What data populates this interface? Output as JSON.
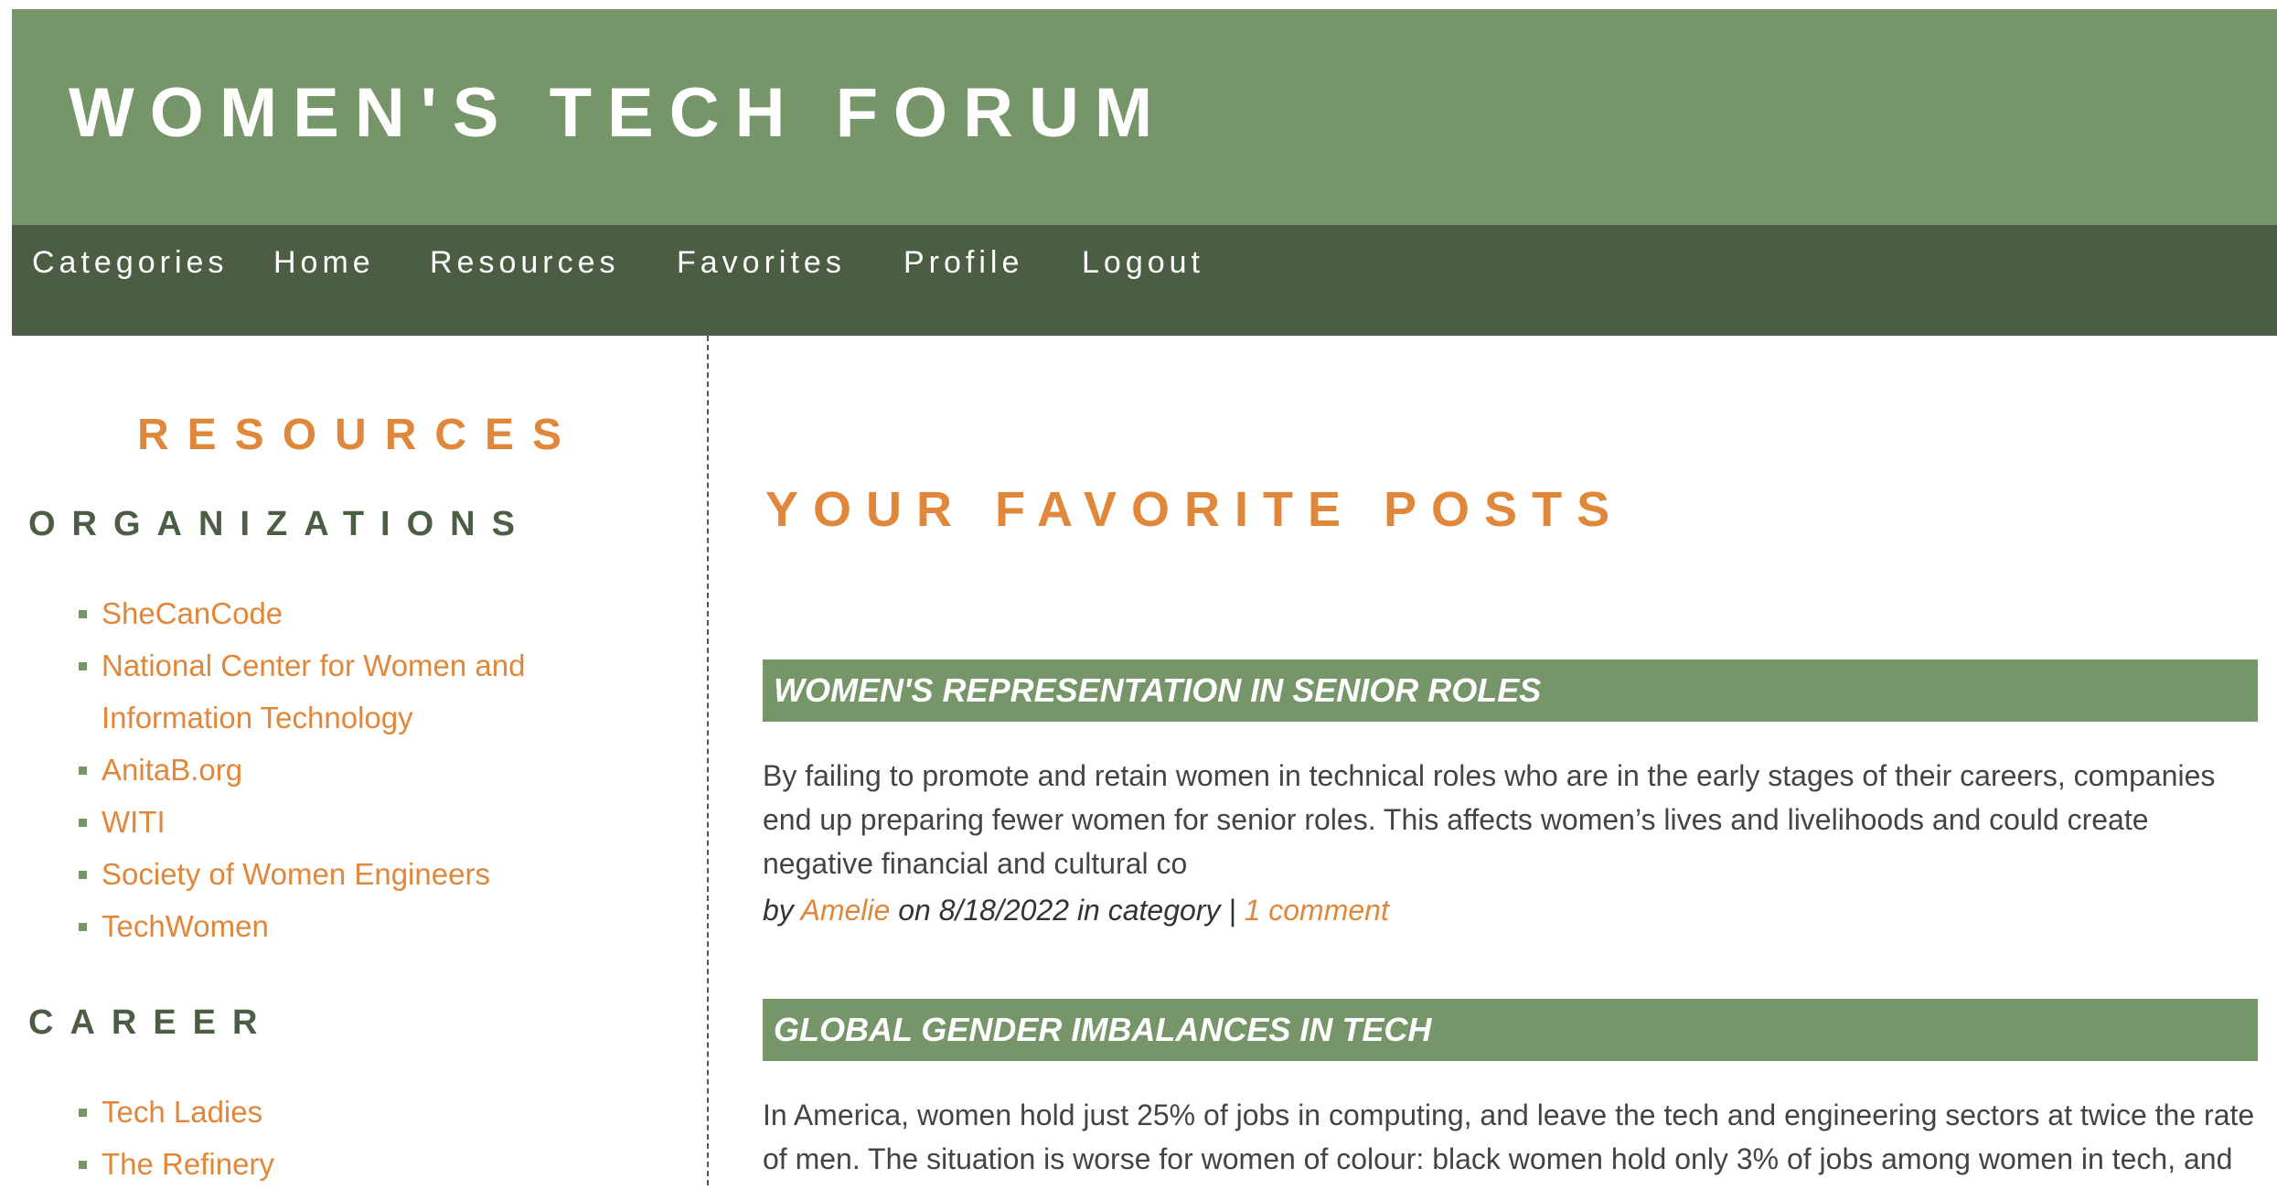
{
  "header": {
    "site_title": "WOMEN'S TECH FORUM"
  },
  "nav": {
    "items": [
      {
        "label": "Categories"
      },
      {
        "label": "Home"
      },
      {
        "label": "Resources"
      },
      {
        "label": "Favorites"
      },
      {
        "label": "Profile"
      },
      {
        "label": "Logout"
      }
    ]
  },
  "sidebar": {
    "title": "RESOURCES",
    "sections": [
      {
        "heading": "ORGANIZATIONS",
        "items": [
          {
            "label": "SheCanCode"
          },
          {
            "label": "National Center for Women and Information Technology"
          },
          {
            "label": "AnitaB.org"
          },
          {
            "label": "WITI"
          },
          {
            "label": "Society of Women Engineers"
          },
          {
            "label": "TechWomen"
          }
        ]
      },
      {
        "heading": "CAREER",
        "items": [
          {
            "label": "Tech Ladies"
          },
          {
            "label": "The Refinery"
          }
        ]
      }
    ]
  },
  "main": {
    "title": "YOUR FAVORITE POSTS",
    "posts": [
      {
        "title": "WOMEN'S REPRESENTATION IN SENIOR ROLES",
        "excerpt": "By failing to promote and retain women in technical roles who are in the early stages of their careers, companies end up preparing fewer women for senior roles. This affects women’s lives and livelihoods and could create negative financial and cultural co",
        "meta": {
          "by": "by",
          "author": "Amelie",
          "on_text": "on 8/18/2022 in category |",
          "comments": "1 comment"
        }
      },
      {
        "title": "GLOBAL GENDER IMBALANCES IN TECH",
        "excerpt": "In America, women hold just 25% of jobs in computing, and leave the tech and engineering sectors at twice the rate of men. The situation is worse for women of colour: black women hold only 3% of jobs among women in tech, and"
      }
    ]
  },
  "colors": {
    "header_green": "#76966a",
    "nav_dark_green": "#4b5e43",
    "accent_orange": "#e0873a",
    "bullet_green": "#76966a"
  }
}
